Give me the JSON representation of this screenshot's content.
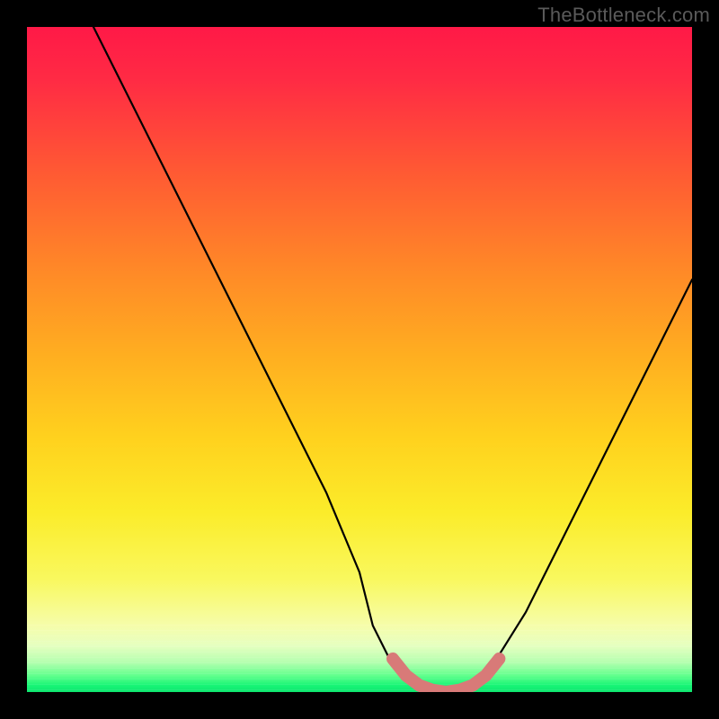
{
  "watermark": "TheBottleneck.com",
  "chart_data": {
    "type": "line",
    "title": "",
    "xlabel": "",
    "ylabel": "",
    "xlim": [
      0,
      100
    ],
    "ylim": [
      0,
      100
    ],
    "grid": false,
    "legend": false,
    "series": [
      {
        "name": "bottleneck-curve",
        "color": "#000000",
        "x": [
          10,
          15,
          20,
          25,
          30,
          35,
          40,
          45,
          50,
          52,
          55,
          58,
          61,
          64,
          67,
          70,
          75,
          80,
          85,
          90,
          95,
          100
        ],
        "y": [
          100,
          90,
          80,
          70,
          60,
          50,
          40,
          30,
          18,
          10,
          4,
          1,
          0,
          0,
          1,
          4,
          12,
          22,
          32,
          42,
          52,
          62
        ]
      },
      {
        "name": "optimal-zone-highlight",
        "color": "#d87a78",
        "x": [
          55,
          57,
          59,
          61,
          63,
          65,
          67,
          69,
          71
        ],
        "y": [
          5,
          2.5,
          1,
          0.3,
          0,
          0.3,
          1,
          2.5,
          5
        ]
      }
    ],
    "gradient_stops": [
      {
        "pos": 0,
        "color": "#ff1947"
      },
      {
        "pos": 0.22,
        "color": "#ff5a33"
      },
      {
        "pos": 0.5,
        "color": "#ffb020"
      },
      {
        "pos": 0.73,
        "color": "#fbec2a"
      },
      {
        "pos": 0.9,
        "color": "#f6fdaa"
      },
      {
        "pos": 0.97,
        "color": "#63ff8d"
      },
      {
        "pos": 1.0,
        "color": "#0de56e"
      }
    ]
  }
}
